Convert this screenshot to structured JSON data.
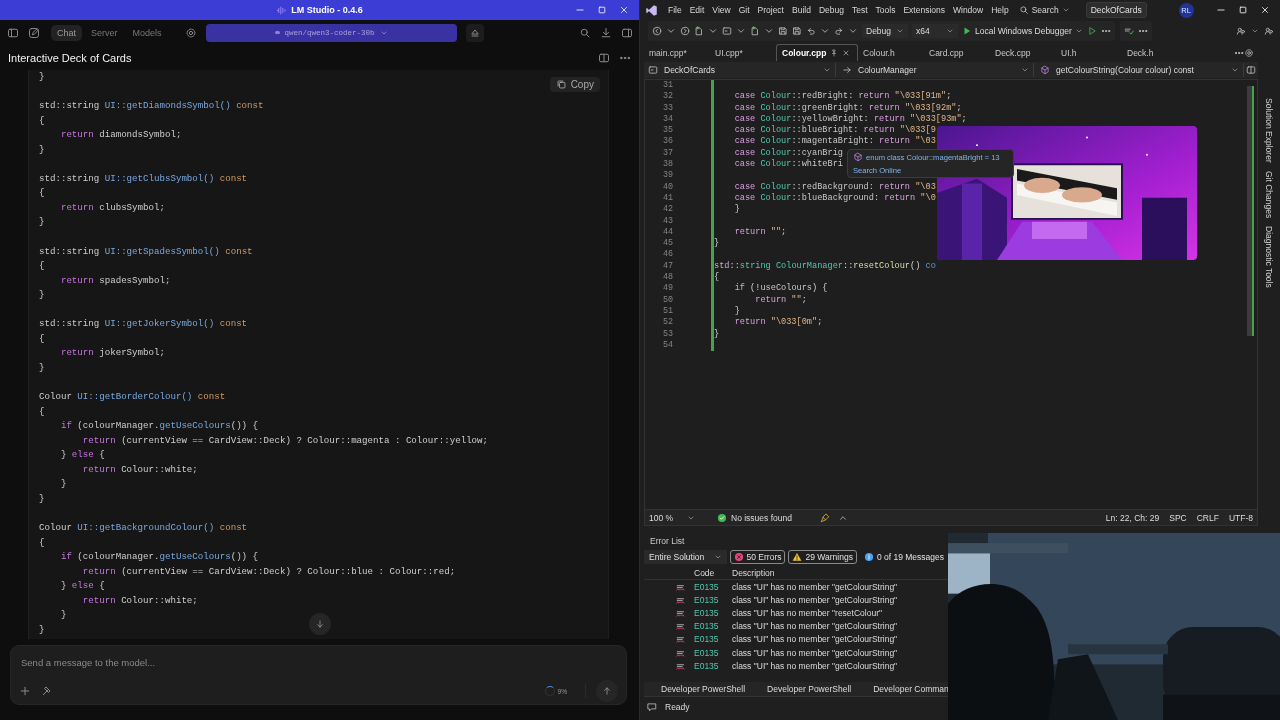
{
  "lm_studio": {
    "window": {
      "title": "LM Studio - 0.4.6"
    },
    "nav_tabs": [
      {
        "label": "Chat",
        "selected": true
      },
      {
        "label": "Server",
        "selected": false
      },
      {
        "label": "Models",
        "selected": false
      }
    ],
    "model_selector": {
      "value": "qwen/qwen3-coder-30b"
    },
    "chat_title": "Interactive Deck of Cards",
    "code_block": {
      "copy_button": "Copy",
      "lines": [
        {
          "kind": "code",
          "segs": [
            {
              "kind": "plain",
              "text": "}"
            }
          ]
        },
        {
          "kind": "blank"
        },
        {
          "kind": "code",
          "segs": [
            {
              "kind": "plain",
              "text": "std::string "
            },
            {
              "kind": "function",
              "text": "UI::getDiamondsSymbol() "
            },
            {
              "kind": "constant",
              "text": "const"
            }
          ]
        },
        {
          "kind": "code",
          "segs": [
            {
              "kind": "plain",
              "text": "{"
            }
          ]
        },
        {
          "kind": "code",
          "segs": [
            {
              "kind": "keyword",
              "text": "    return"
            },
            {
              "kind": "plain",
              "text": " diamondsSymbol;"
            }
          ]
        },
        {
          "kind": "code",
          "segs": [
            {
              "kind": "plain",
              "text": "}"
            }
          ]
        },
        {
          "kind": "blank"
        },
        {
          "kind": "code",
          "segs": [
            {
              "kind": "plain",
              "text": "std::string "
            },
            {
              "kind": "function",
              "text": "UI::getClubsSymbol() "
            },
            {
              "kind": "constant",
              "text": "const"
            }
          ]
        },
        {
          "kind": "code",
          "segs": [
            {
              "kind": "plain",
              "text": "{"
            }
          ]
        },
        {
          "kind": "code",
          "segs": [
            {
              "kind": "keyword",
              "text": "    return"
            },
            {
              "kind": "plain",
              "text": " clubsSymbol;"
            }
          ]
        },
        {
          "kind": "code",
          "segs": [
            {
              "kind": "plain",
              "text": "}"
            }
          ]
        },
        {
          "kind": "blank"
        },
        {
          "kind": "code",
          "segs": [
            {
              "kind": "plain",
              "text": "std::string "
            },
            {
              "kind": "function",
              "text": "UI::getSpadesSymbol() "
            },
            {
              "kind": "constant",
              "text": "const"
            }
          ]
        },
        {
          "kind": "code",
          "segs": [
            {
              "kind": "plain",
              "text": "{"
            }
          ]
        },
        {
          "kind": "code",
          "segs": [
            {
              "kind": "keyword",
              "text": "    return"
            },
            {
              "kind": "plain",
              "text": " spadesSymbol;"
            }
          ]
        },
        {
          "kind": "code",
          "segs": [
            {
              "kind": "plain",
              "text": "}"
            }
          ]
        },
        {
          "kind": "blank"
        },
        {
          "kind": "code",
          "segs": [
            {
              "kind": "plain",
              "text": "std::string "
            },
            {
              "kind": "function",
              "text": "UI::getJokerSymbol() "
            },
            {
              "kind": "constant",
              "text": "const"
            }
          ]
        },
        {
          "kind": "code",
          "segs": [
            {
              "kind": "plain",
              "text": "{"
            }
          ]
        },
        {
          "kind": "code",
          "segs": [
            {
              "kind": "keyword",
              "text": "    return"
            },
            {
              "kind": "plain",
              "text": " jokerSymbol;"
            }
          ]
        },
        {
          "kind": "code",
          "segs": [
            {
              "kind": "plain",
              "text": "}"
            }
          ]
        },
        {
          "kind": "blank"
        },
        {
          "kind": "code",
          "segs": [
            {
              "kind": "plain",
              "text": "Colour "
            },
            {
              "kind": "function",
              "text": "UI::getBorderColour() "
            },
            {
              "kind": "constant",
              "text": "const"
            }
          ]
        },
        {
          "kind": "code",
          "segs": [
            {
              "kind": "plain",
              "text": "{"
            }
          ]
        },
        {
          "kind": "code",
          "segs": [
            {
              "kind": "keyword",
              "text": "    if"
            },
            {
              "kind": "plain",
              "text": " (colourManager."
            },
            {
              "kind": "function",
              "text": "getUseColours"
            },
            {
              "kind": "plain",
              "text": "()) {"
            }
          ]
        },
        {
          "kind": "code",
          "segs": [
            {
              "kind": "keyword",
              "text": "        return"
            },
            {
              "kind": "plain",
              "text": " (currentView == CardView::Deck) ? Colour::magenta : Colour::yellow;"
            }
          ]
        },
        {
          "kind": "code",
          "segs": [
            {
              "kind": "plain",
              "text": "    } "
            },
            {
              "kind": "keyword",
              "text": "else"
            },
            {
              "kind": "plain",
              "text": " {"
            }
          ]
        },
        {
          "kind": "code",
          "segs": [
            {
              "kind": "keyword",
              "text": "        return"
            },
            {
              "kind": "plain",
              "text": " Colour::white;"
            }
          ]
        },
        {
          "kind": "code",
          "segs": [
            {
              "kind": "plain",
              "text": "    }"
            }
          ]
        },
        {
          "kind": "code",
          "segs": [
            {
              "kind": "plain",
              "text": "}"
            }
          ]
        },
        {
          "kind": "blank"
        },
        {
          "kind": "code",
          "segs": [
            {
              "kind": "plain",
              "text": "Colour "
            },
            {
              "kind": "function",
              "text": "UI::getBackgroundColour() "
            },
            {
              "kind": "constant",
              "text": "const"
            }
          ]
        },
        {
          "kind": "code",
          "segs": [
            {
              "kind": "plain",
              "text": "{"
            }
          ]
        },
        {
          "kind": "code",
          "segs": [
            {
              "kind": "keyword",
              "text": "    if"
            },
            {
              "kind": "plain",
              "text": " (colourManager."
            },
            {
              "kind": "function",
              "text": "getUseColours"
            },
            {
              "kind": "plain",
              "text": "()) {"
            }
          ]
        },
        {
          "kind": "code",
          "segs": [
            {
              "kind": "keyword",
              "text": "        return"
            },
            {
              "kind": "plain",
              "text": " (currentView == CardView::Deck) ? Colour::blue : Colour::red;"
            }
          ]
        },
        {
          "kind": "code",
          "segs": [
            {
              "kind": "plain",
              "text": "    } "
            },
            {
              "kind": "keyword",
              "text": "else"
            },
            {
              "kind": "plain",
              "text": " {"
            }
          ]
        },
        {
          "kind": "code",
          "segs": [
            {
              "kind": "keyword",
              "text": "        return"
            },
            {
              "kind": "plain",
              "text": " Colour::white;"
            }
          ]
        },
        {
          "kind": "code",
          "segs": [
            {
              "kind": "plain",
              "text": "    }"
            }
          ]
        },
        {
          "kind": "code",
          "segs": [
            {
              "kind": "plain",
              "text": "}"
            }
          ]
        }
      ]
    },
    "composer": {
      "placeholder": "Send a message to the model...",
      "context_usage": "9%"
    }
  },
  "visual_studio": {
    "menu": [
      "File",
      "Edit",
      "View",
      "Git",
      "Project",
      "Build",
      "Debug",
      "Test",
      "Tools",
      "Extensions",
      "Window",
      "Help"
    ],
    "search": "Search",
    "solution_name": "DeckOfCards",
    "user_initials": "RL",
    "toolbar": {
      "configuration": "Debug",
      "platform": "x64",
      "debugger": "Local Windows Debugger"
    },
    "tabs": [
      {
        "label": "main.cpp*",
        "selected": false
      },
      {
        "label": "UI.cpp*",
        "selected": false
      },
      {
        "label": "Colour.cpp",
        "selected": true
      },
      {
        "label": "Colour.h",
        "selected": false
      },
      {
        "label": "Card.cpp",
        "selected": false
      },
      {
        "label": "Deck.cpp",
        "selected": false
      },
      {
        "label": "UI.h",
        "selected": false
      },
      {
        "label": "Deck.h",
        "selected": false
      }
    ],
    "navigation": [
      "DeckOfCards",
      "ColourManager",
      "getColourString(Colour colour) const"
    ],
    "editor": {
      "lines": [
        {
          "number": "31",
          "kind": "blank"
        },
        {
          "number": "32",
          "kind": "code",
          "segs": [
            {
              "kind": "keyword",
              "text": "    case "
            },
            {
              "kind": "type",
              "text": "Colour"
            },
            {
              "kind": "plain",
              "text": "::"
            },
            {
              "kind": "member",
              "text": "redBright"
            },
            {
              "kind": "plain",
              "text": ": "
            },
            {
              "kind": "keyword",
              "text": "return "
            },
            {
              "kind": "string",
              "text": "\"\\033[91m\""
            },
            {
              "kind": "plain",
              "text": ";"
            }
          ]
        },
        {
          "number": "33",
          "kind": "code",
          "segs": [
            {
              "kind": "keyword",
              "text": "    case "
            },
            {
              "kind": "type",
              "text": "Colour"
            },
            {
              "kind": "plain",
              "text": "::"
            },
            {
              "kind": "member",
              "text": "greenBright"
            },
            {
              "kind": "plain",
              "text": ": "
            },
            {
              "kind": "keyword",
              "text": "return "
            },
            {
              "kind": "string",
              "text": "\"\\033[92m\""
            },
            {
              "kind": "plain",
              "text": ";"
            }
          ]
        },
        {
          "number": "34",
          "kind": "code",
          "segs": [
            {
              "kind": "keyword",
              "text": "    case "
            },
            {
              "kind": "type",
              "text": "Colour"
            },
            {
              "kind": "plain",
              "text": "::"
            },
            {
              "kind": "member",
              "text": "yellowBright"
            },
            {
              "kind": "plain",
              "text": ": "
            },
            {
              "kind": "keyword",
              "text": "return "
            },
            {
              "kind": "string",
              "text": "\"\\033[93m\""
            },
            {
              "kind": "plain",
              "text": ";"
            }
          ]
        },
        {
          "number": "35",
          "kind": "code",
          "segs": [
            {
              "kind": "keyword",
              "text": "    case "
            },
            {
              "kind": "type",
              "text": "Colour"
            },
            {
              "kind": "plain",
              "text": "::"
            },
            {
              "kind": "member",
              "text": "blueBright"
            },
            {
              "kind": "plain",
              "text": ": "
            },
            {
              "kind": "keyword",
              "text": "return "
            },
            {
              "kind": "string",
              "text": "\"\\033[9"
            }
          ]
        },
        {
          "number": "36",
          "kind": "code",
          "segs": [
            {
              "kind": "keyword",
              "text": "    case "
            },
            {
              "kind": "type",
              "text": "Colour"
            },
            {
              "kind": "plain",
              "text": "::"
            },
            {
              "kind": "member",
              "text": "magentaBright"
            },
            {
              "kind": "plain",
              "text": ": "
            },
            {
              "kind": "keyword",
              "text": "return "
            },
            {
              "kind": "string",
              "text": "\"\\03"
            }
          ]
        },
        {
          "number": "37",
          "kind": "code",
          "segs": [
            {
              "kind": "keyword",
              "text": "    case "
            },
            {
              "kind": "type",
              "text": "Colour"
            },
            {
              "kind": "plain",
              "text": "::"
            },
            {
              "kind": "member",
              "text": "cyanBrig"
            }
          ]
        },
        {
          "number": "38",
          "kind": "code",
          "segs": [
            {
              "kind": "keyword",
              "text": "    case "
            },
            {
              "kind": "type",
              "text": "Colour"
            },
            {
              "kind": "plain",
              "text": "::"
            },
            {
              "kind": "member",
              "text": "whiteBri"
            }
          ]
        },
        {
          "number": "39",
          "kind": "blank"
        },
        {
          "number": "40",
          "kind": "code",
          "segs": [
            {
              "kind": "keyword",
              "text": "    case "
            },
            {
              "kind": "type",
              "text": "Colour"
            },
            {
              "kind": "plain",
              "text": "::"
            },
            {
              "kind": "member",
              "text": "redBackground"
            },
            {
              "kind": "plain",
              "text": ": "
            },
            {
              "kind": "keyword",
              "text": "return "
            },
            {
              "kind": "string",
              "text": "\"\\03"
            }
          ]
        },
        {
          "number": "41",
          "kind": "code",
          "segs": [
            {
              "kind": "keyword",
              "text": "    case "
            },
            {
              "kind": "type",
              "text": "Colour"
            },
            {
              "kind": "plain",
              "text": "::"
            },
            {
              "kind": "member",
              "text": "blueBackground"
            },
            {
              "kind": "plain",
              "text": ": "
            },
            {
              "kind": "keyword",
              "text": "return "
            },
            {
              "kind": "string",
              "text": "\"\\0"
            }
          ]
        },
        {
          "number": "42",
          "kind": "code",
          "segs": [
            {
              "kind": "plain",
              "text": "    }"
            }
          ]
        },
        {
          "number": "43",
          "kind": "blank"
        },
        {
          "number": "44",
          "kind": "code",
          "segs": [
            {
              "kind": "keyword",
              "text": "    return "
            },
            {
              "kind": "string",
              "text": "\"\""
            },
            {
              "kind": "plain",
              "text": ";"
            }
          ]
        },
        {
          "number": "45",
          "kind": "code",
          "segs": [
            {
              "kind": "plain",
              "text": "}"
            }
          ]
        },
        {
          "number": "46",
          "kind": "blank"
        },
        {
          "number": "47",
          "kind": "code",
          "segs": [
            {
              "kind": "keyword",
              "text": "std"
            },
            {
              "kind": "plain",
              "text": "::"
            },
            {
              "kind": "type",
              "text": "string ColourManager"
            },
            {
              "kind": "plain",
              "text": "::"
            },
            {
              "kind": "function",
              "text": "resetColour"
            },
            {
              "kind": "plain",
              "text": "() "
            },
            {
              "kind": "constant",
              "text": "co"
            }
          ]
        },
        {
          "number": "48",
          "kind": "code",
          "segs": [
            {
              "kind": "plain",
              "text": "{"
            }
          ]
        },
        {
          "number": "49",
          "kind": "code",
          "segs": [
            {
              "kind": "keyword",
              "text": "    if"
            },
            {
              "kind": "plain",
              "text": " (!"
            },
            {
              "kind": "member",
              "text": "useColours"
            },
            {
              "kind": "plain",
              "text": ") {"
            }
          ]
        },
        {
          "number": "50",
          "kind": "code",
          "segs": [
            {
              "kind": "keyword",
              "text": "        return "
            },
            {
              "kind": "string",
              "text": "\"\""
            },
            {
              "kind": "plain",
              "text": ";"
            }
          ]
        },
        {
          "number": "51",
          "kind": "code",
          "segs": [
            {
              "kind": "plain",
              "text": "    }"
            }
          ]
        },
        {
          "number": "52",
          "kind": "code",
          "segs": [
            {
              "kind": "keyword",
              "text": "    return "
            },
            {
              "kind": "string",
              "text": "\"\\033[0m\""
            },
            {
              "kind": "plain",
              "text": ";"
            }
          ]
        },
        {
          "number": "53",
          "kind": "code",
          "segs": [
            {
              "kind": "plain",
              "text": "}"
            }
          ]
        },
        {
          "number": "54",
          "kind": "blank"
        }
      ]
    },
    "tooltip": {
      "signature": "enum class Colour::magentaBright = 13",
      "link": "Search Online"
    },
    "status": {
      "zoom": "100 %",
      "issues": "No issues found",
      "position": "Ln: 22, Ch: 29",
      "indent": "SPC",
      "line_endings": "CRLF",
      "encoding": "UTF-8"
    },
    "error_list": {
      "title": "Error List",
      "scope": "Entire Solution",
      "filters": [
        {
          "kind": "error",
          "label": "50 Errors",
          "selected": true
        },
        {
          "kind": "warning",
          "label": "29 Warnings",
          "selected": true
        },
        {
          "kind": "message",
          "label": "0 of 19 Messages",
          "selected": false
        }
      ],
      "columns": [
        "Code",
        "Description"
      ],
      "rows": [
        {
          "code": "E0135",
          "description": "class \"UI\" has no member \"getColourString\""
        },
        {
          "code": "E0135",
          "description": "class \"UI\" has no member \"getColourString\""
        },
        {
          "code": "E0135",
          "description": "class \"UI\" has no member \"resetColour\""
        },
        {
          "code": "E0135",
          "description": "class \"UI\" has no member \"getColourString\""
        },
        {
          "code": "E0135",
          "description": "class \"UI\" has no member \"getColourString\""
        },
        {
          "code": "E0135",
          "description": "class \"UI\" has no member \"getColourString\""
        },
        {
          "code": "E0135",
          "description": "class \"UI\" has no member \"getColourString\""
        }
      ]
    },
    "bottom_tabs": [
      "Developer PowerShell",
      "Developer PowerShell",
      "Developer Comman"
    ],
    "side_tabs": [
      "Solution Explorer",
      "Git Changes",
      "Diagnostic Tools"
    ],
    "status_bar": "Ready"
  }
}
